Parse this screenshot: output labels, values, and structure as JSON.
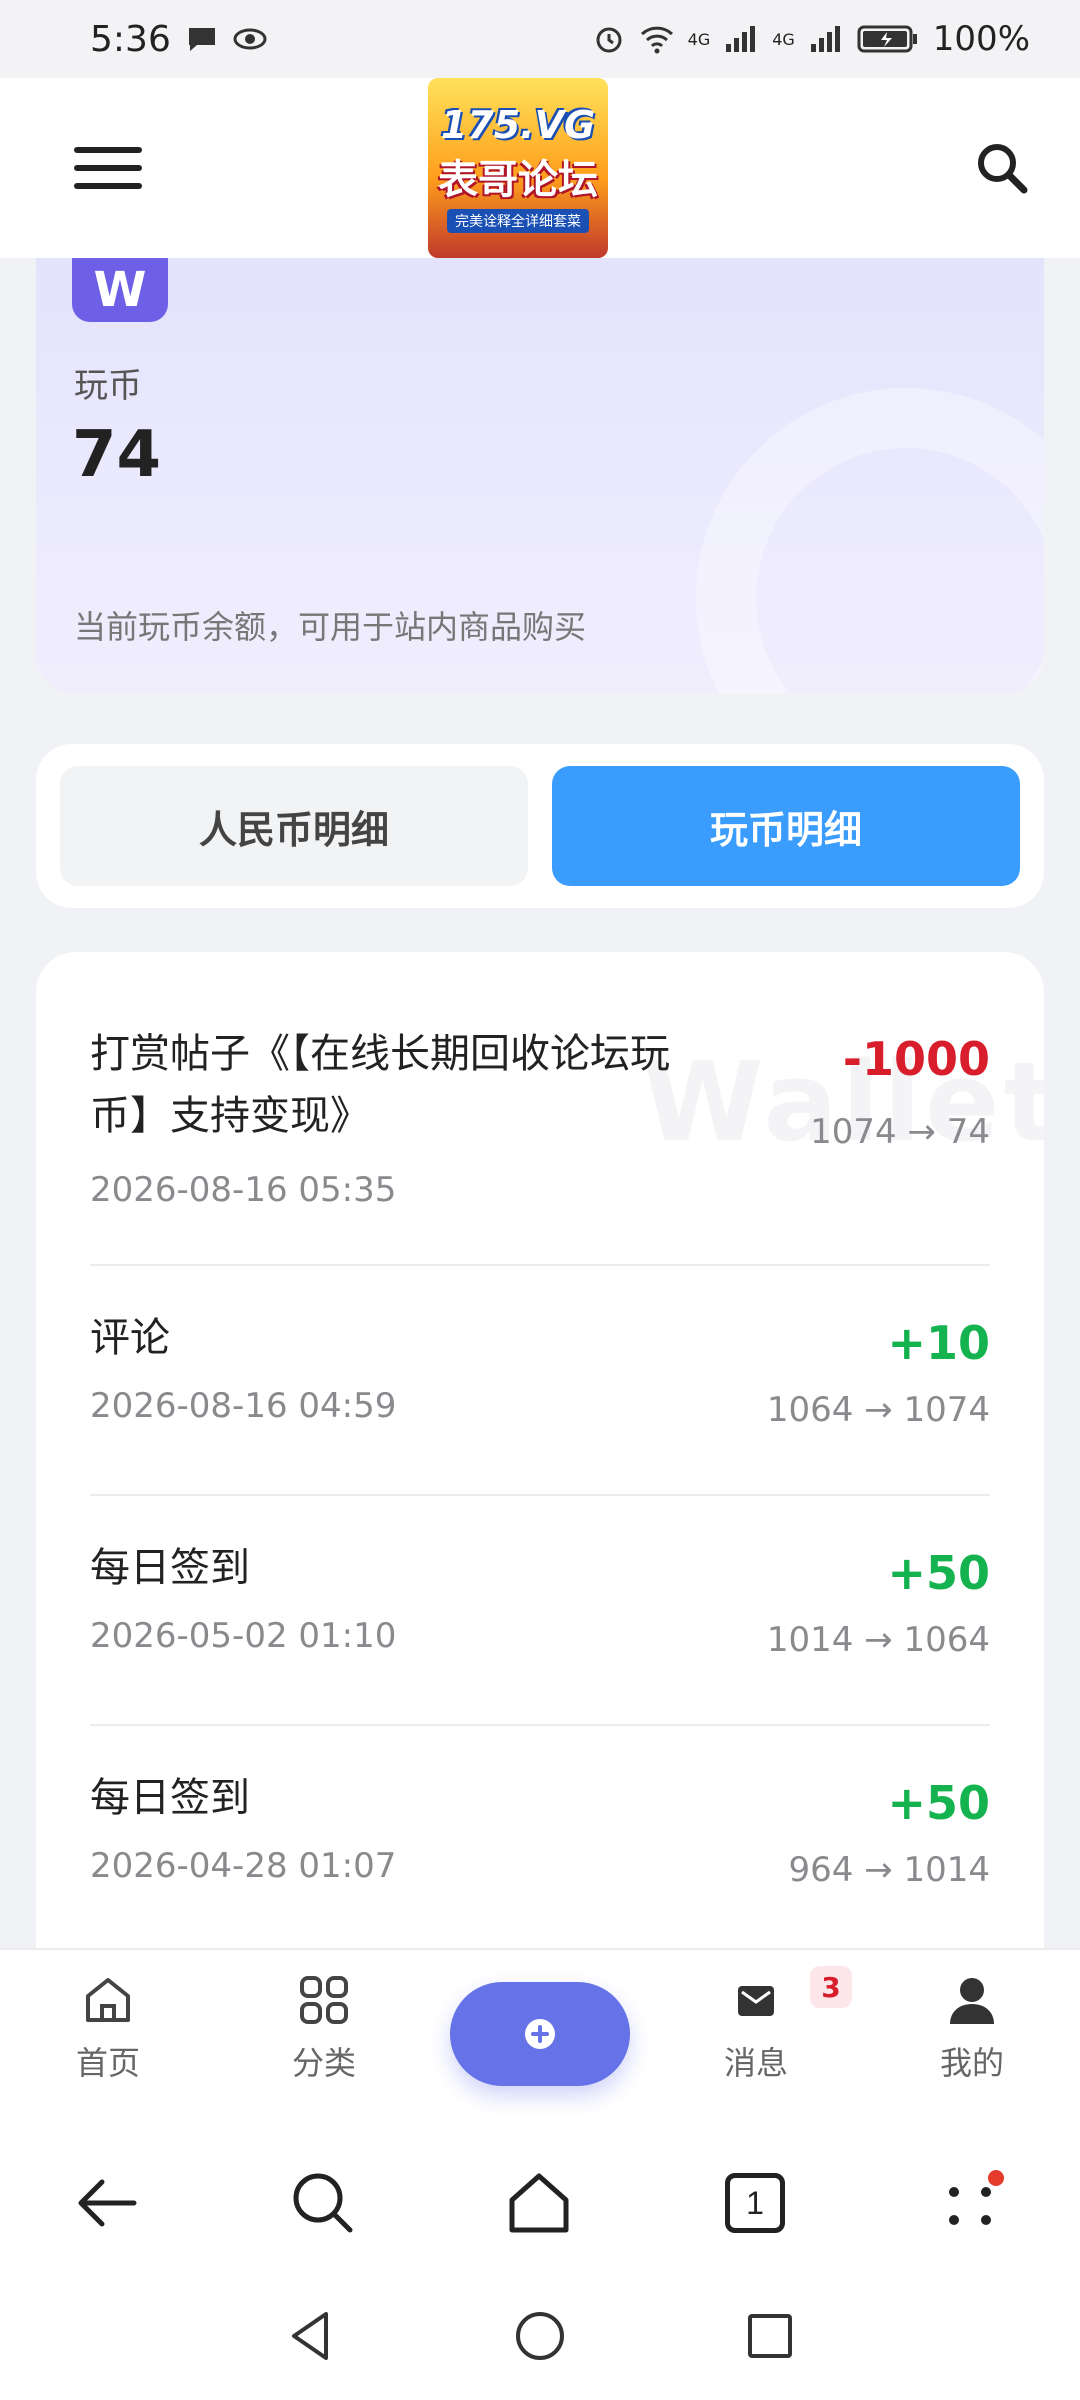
{
  "status_bar": {
    "time": "5:36",
    "battery": "100%",
    "network_1": "4G",
    "network_2": "4G"
  },
  "header": {
    "logo_title": "175.VG",
    "logo_subtitle": "表哥论坛",
    "logo_tagline": "完美诠释全详细套菜"
  },
  "balance": {
    "badge": "W",
    "label": "玩币",
    "value": "74",
    "description": "当前玩币余额，可用于站内商品购买"
  },
  "tabs": [
    {
      "label": "人民币明细",
      "active": false
    },
    {
      "label": "玩币明细",
      "active": true
    }
  ],
  "watermark": "Wallet",
  "transactions": [
    {
      "title_line1": "打赏帖子《【在线长期回收论坛玩",
      "title_line2": "币】支持变现》",
      "date": "2026-08-16 05:35",
      "amount": "-1000",
      "balance": "1074 → 74",
      "type": "neg"
    },
    {
      "title_line1": "评论",
      "title_line2": "",
      "date": "2026-08-16 04:59",
      "amount": "+10",
      "balance": "1064 → 1074",
      "type": "pos"
    },
    {
      "title_line1": "每日签到",
      "title_line2": "",
      "date": "2026-05-02 01:10",
      "amount": "+50",
      "balance": "1014 → 1064",
      "type": "pos"
    },
    {
      "title_line1": "每日签到",
      "title_line2": "",
      "date": "2026-04-28 01:07",
      "amount": "+50",
      "balance": "964 → 1014",
      "type": "pos"
    }
  ],
  "bottom_nav": {
    "home": "首页",
    "category": "分类",
    "messages": "消息",
    "messages_badge": "3",
    "mine": "我的"
  },
  "browser_bar": {
    "tab_count": "1"
  },
  "colors": {
    "accent_blue": "#3a9cfd",
    "accent_purple": "#6572e8",
    "negative": "#d81e2c",
    "positive": "#15b350"
  }
}
